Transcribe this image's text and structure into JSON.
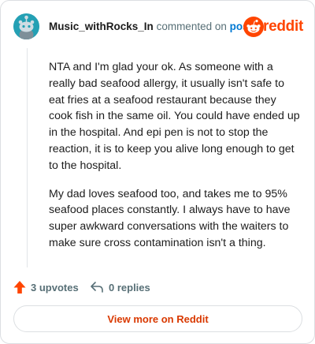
{
  "header": {
    "author": "Music_withRocks_In",
    "action_text": "commented on",
    "post_link": "post",
    "brand_name": "reddit",
    "avatar_icon": "snoo-avatar-icon",
    "brand_icon": "reddit-logo-icon"
  },
  "comment": {
    "paragraphs": [
      "NTA and I'm glad your ok. As someone with a really bad seafood allergy, it usually isn't safe to eat fries at a seafood restaurant because they cook fish in the same oil. You could have ended up in the hospital. And epi pen is not to stop the reaction, it is to keep you alive long enough to get to the hospital.",
      "My dad loves seafood too, and takes me to 95% seafood places constantly. I always have to have super awkward conversations with the waiters to make sure cross contamination isn't a thing."
    ]
  },
  "actions": {
    "upvotes_label": "3 upvotes",
    "replies_label": "0 replies",
    "upvote_icon": "upvote-arrow-icon",
    "reply_icon": "reply-arrow-icon"
  },
  "footer": {
    "view_more_label": "View more on Reddit"
  },
  "colors": {
    "accent": "#ff4500",
    "link": "#0079d3",
    "muted": "#576f76",
    "view_more": "#d93900",
    "avatar_bg": "#24a0b4"
  }
}
